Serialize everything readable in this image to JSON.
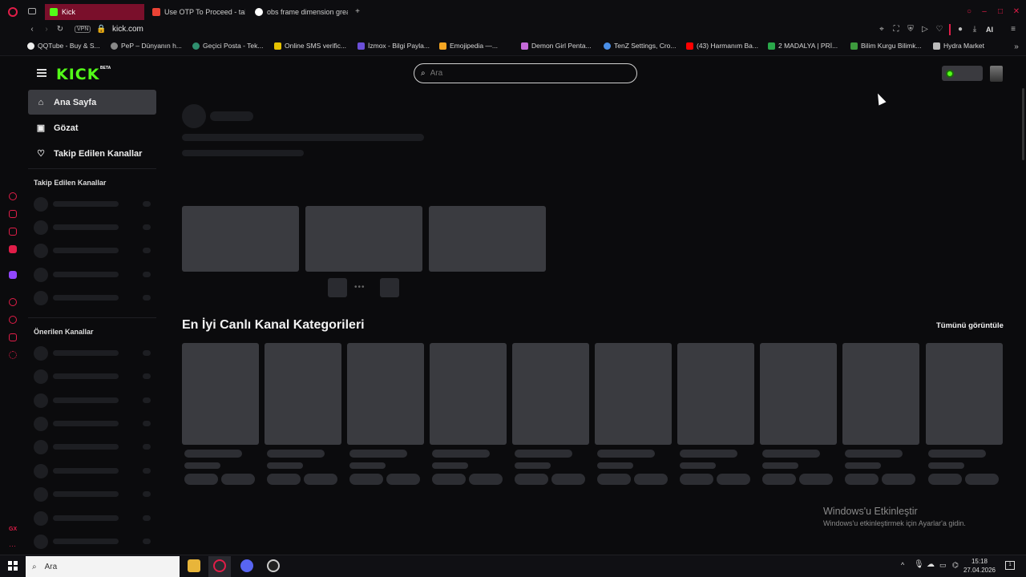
{
  "tabs": [
    {
      "label": "Kick"
    },
    {
      "label": "Use OTP To Proceed - tah"
    },
    {
      "label": "obs frame dimension great"
    }
  ],
  "address": {
    "url": "kick.com",
    "vpn": "VPN"
  },
  "bookmarks": [
    "QQTube - Buy & S...",
    "PeP – Dünyanın h...",
    "Geçici Posta - Tek...",
    "Online SMS verific...",
    "İzmox - Bilgi Payla...",
    "Emojipedia —...",
    "Demon Girl Penta...",
    "TenZ Settings, Cro...",
    "(43) Harmanım Ba...",
    "2 MADALYA | PRİ...",
    "Bilim Kurgu Bilimk...",
    "Hydra Market"
  ],
  "browser_ai": "AI",
  "header": {
    "logo": "KICK",
    "beta": "BETA",
    "search_placeholder": "Ara"
  },
  "nav": [
    {
      "label": "Ana Sayfa",
      "icon": "home-icon"
    },
    {
      "label": "Gözat",
      "icon": "browse-icon"
    },
    {
      "label": "Takip Edilen Kanallar",
      "icon": "heart-icon"
    }
  ],
  "sidebar": {
    "followed_heading": "Takip Edilen Kanallar",
    "recommended_heading": "Önerilen Kanallar"
  },
  "main": {
    "categories_title": "En İyi Canlı Kanal Kategorileri",
    "view_all": "Tümünü görüntüle"
  },
  "watermark": {
    "line1": "Windows'u Etkinleştir",
    "line2": "Windows'u etkinleştirmek için Ayarlar'a gidin."
  },
  "taskbar": {
    "search_placeholder": "Ara",
    "time": "15:18",
    "date": "27.04.2026",
    "notifications": "1"
  },
  "gx_label": "GX",
  "colors": {
    "brand": "#53fc18",
    "active_tab": "#7a0f2b",
    "background": "#0b0b0d"
  }
}
